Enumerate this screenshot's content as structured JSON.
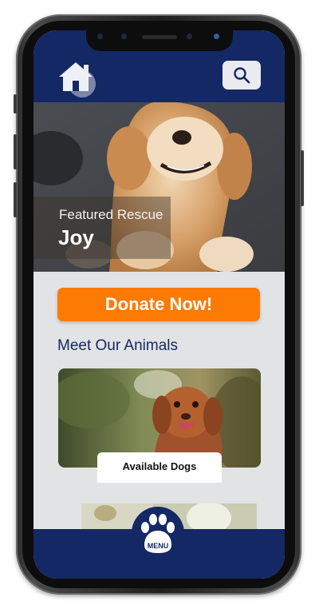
{
  "header": {
    "home_icon": "home-icon",
    "search_icon": "search-icon"
  },
  "hero": {
    "kicker": "Featured Rescue",
    "name": "Joy"
  },
  "actions": {
    "donate_label": "Donate Now!"
  },
  "section": {
    "title": "Meet Our Animals"
  },
  "cards": [
    {
      "label": "Available Dogs"
    }
  ],
  "nav": {
    "menu_label": "MENU",
    "menu_icon": "paw-icon"
  },
  "colors": {
    "brand_navy": "#142866",
    "accent_orange": "#fd7a04",
    "background": "#e2e3e5"
  }
}
